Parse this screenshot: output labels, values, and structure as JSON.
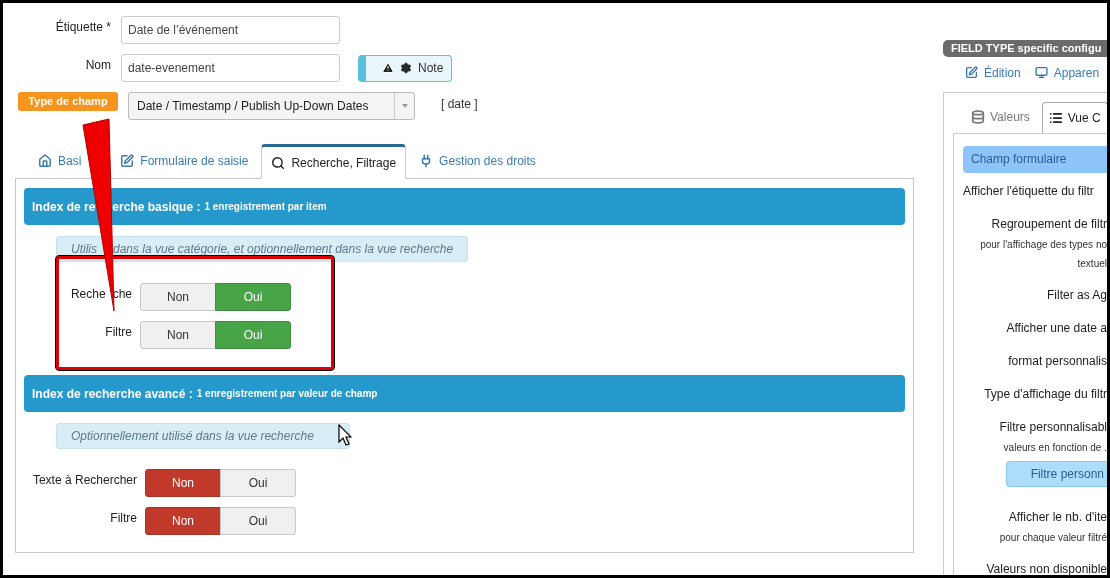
{
  "fields": [
    {
      "label": "Étiquette *",
      "value": "Date de l’événement"
    },
    {
      "label": "Nom",
      "value": "date-evenement"
    }
  ],
  "note_button": {
    "label": "Note"
  },
  "field_type": {
    "badge": "Type de champ",
    "value": "Date / Timestamp / Publish Up-Down Dates",
    "code": "[ date ]"
  },
  "tabs": [
    {
      "label": "Basi",
      "selected": false
    },
    {
      "label": "Formulaire de saisie",
      "selected": false
    },
    {
      "label": "Recherche, Filtrage",
      "selected": true
    },
    {
      "label": "Gestion des droits",
      "selected": false
    }
  ],
  "sections": [
    {
      "title": [
        "Index de re",
        "erche basique :"
      ],
      "subtitle": "1 enregistrement par item",
      "note": [
        "Utilis",
        "dans la vue catégorie, et optionnellement dans la vue recherche"
      ],
      "highlighted": true,
      "options": [
        {
          "label": [
            "Reche",
            "che"
          ],
          "choices": [
            {
              "label": "Non",
              "kind": "no",
              "selected": false
            },
            {
              "label": "Oui",
              "kind": "yes",
              "selected": true
            }
          ]
        },
        {
          "label": [
            "Filtre"
          ],
          "choices": [
            {
              "label": "Non",
              "kind": "no",
              "selected": false
            },
            {
              "label": "Oui",
              "kind": "yes",
              "selected": true
            }
          ]
        }
      ]
    },
    {
      "title": [
        "Index de recherche avancé :"
      ],
      "subtitle": "1 enregistrement par valeur de champ",
      "note": [
        "Optionnellement utilisé dans la vue recherche"
      ],
      "highlighted": false,
      "options": [
        {
          "label": [
            "Texte à Rechercher"
          ],
          "choices": [
            {
              "label": "Non",
              "kind": "no",
              "selected": true
            },
            {
              "label": "Oui",
              "kind": "yes",
              "selected": false
            }
          ]
        },
        {
          "label": [
            "Filtre"
          ],
          "choices": [
            {
              "label": "Non",
              "kind": "no",
              "selected": true
            },
            {
              "label": "Oui",
              "kind": "yes",
              "selected": false
            }
          ]
        }
      ]
    }
  ],
  "side_panel": {
    "header": "FIELD TYPE specific configu",
    "links": [
      "Édition",
      "Apparen"
    ],
    "tabs": [
      {
        "label": "Valeurs",
        "selected": false
      },
      {
        "label": "Vue C",
        "selected": true
      }
    ],
    "group": "Champ formulaire",
    "items": [
      {
        "kind": "heading",
        "text": "Afficher l'étiquette du filtr"
      },
      {
        "kind": "label",
        "text": "Regroupement de filtr"
      },
      {
        "kind": "hint",
        "text": "pour l'affichage des types no"
      },
      {
        "kind": "hint",
        "text": "textuel"
      },
      {
        "kind": "label",
        "text": "Filter as Ag"
      },
      {
        "kind": "label",
        "text": "Afficher une date a"
      },
      {
        "kind": "label",
        "text": "format personnalis"
      },
      {
        "kind": "label",
        "text": "Type d'affichage du filtr"
      },
      {
        "kind": "label",
        "text": "Filtre personnalisabl"
      },
      {
        "kind": "hint",
        "text": "valeurs en fonction de ."
      },
      {
        "kind": "button",
        "text": "Filtre personn"
      },
      {
        "kind": "label",
        "text": "Afficher le nb. d'ite"
      },
      {
        "kind": "hint",
        "text": "pour chaque valeur filtré"
      },
      {
        "kind": "label",
        "text": "Valeurs non disponible"
      }
    ]
  }
}
